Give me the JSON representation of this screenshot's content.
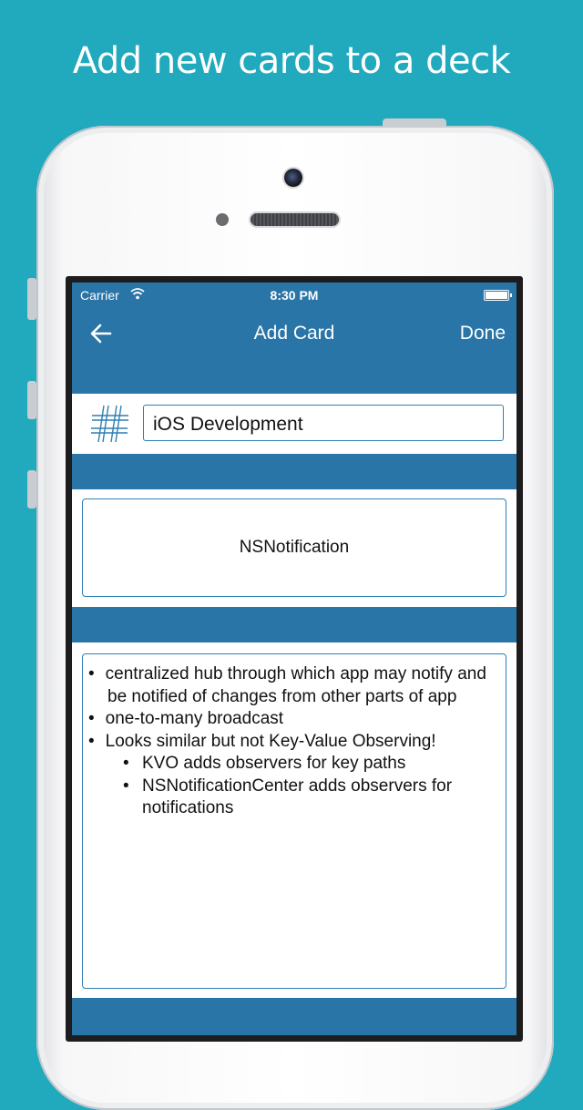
{
  "promo": {
    "headline": "Add new cards to a deck"
  },
  "status_bar": {
    "carrier": "Carrier",
    "time": "8:30 PM"
  },
  "nav": {
    "title": "Add Card",
    "done_label": "Done"
  },
  "deck": {
    "name": "iOS Development",
    "icon": "hashtag-icon"
  },
  "front": {
    "text": "NSNotification"
  },
  "back": {
    "items": [
      {
        "text": "centralized hub through which app may notify and be notified of changes from other parts of app"
      },
      {
        "text": "one-to-many broadcast"
      },
      {
        "text": "Looks similar but not Key-Value Observing!"
      },
      {
        "text": "KVO adds observers for key paths"
      },
      {
        "text": "NSNotificationCenter adds observers for notifications"
      }
    ]
  },
  "colors": {
    "background": "#21a9be",
    "app_blue": "#2a75a7",
    "field_border": "#2f7fb4"
  }
}
